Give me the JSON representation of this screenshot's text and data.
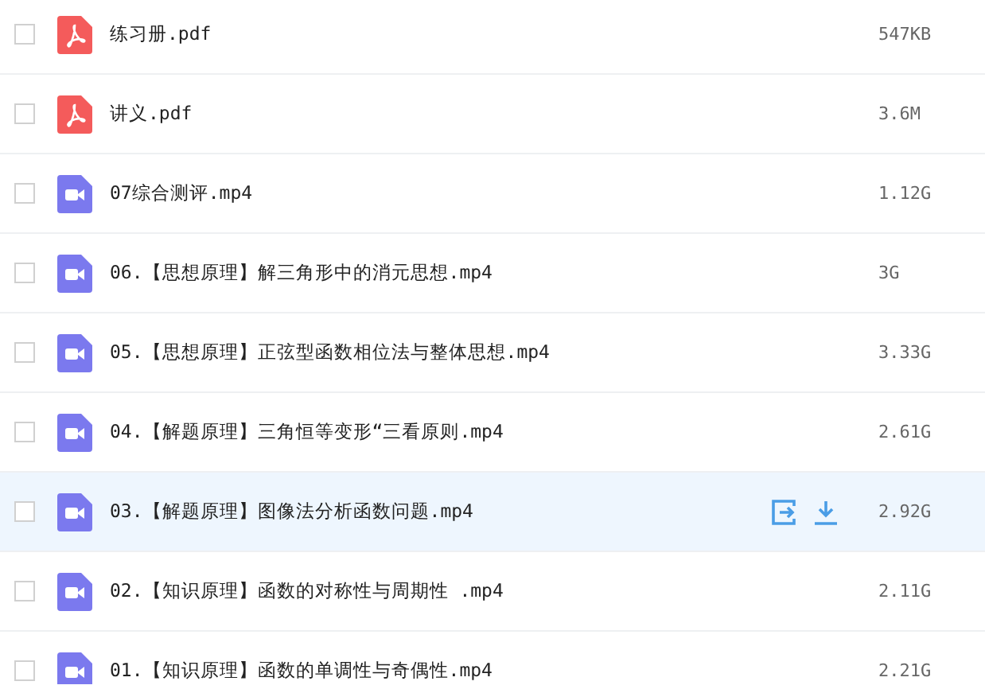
{
  "files": [
    {
      "kind": "pdf",
      "name": "练习册.pdf",
      "size": "547KB",
      "checked": false,
      "hovered": false
    },
    {
      "kind": "pdf",
      "name": "讲义.pdf",
      "size": "3.6M",
      "checked": false,
      "hovered": false
    },
    {
      "kind": "video",
      "name": "07综合测评.mp4",
      "size": "1.12G",
      "checked": false,
      "hovered": false
    },
    {
      "kind": "video",
      "name": "06.【思想原理】解三角形中的消元思想.mp4",
      "size": "3G",
      "checked": false,
      "hovered": false
    },
    {
      "kind": "video",
      "name": "05.【思想原理】正弦型函数相位法与整体思想.mp4",
      "size": "3.33G",
      "checked": false,
      "hovered": false
    },
    {
      "kind": "video",
      "name": "04.【解题原理】三角恒等变形“三看原则.mp4",
      "size": "2.61G",
      "checked": false,
      "hovered": false
    },
    {
      "kind": "video",
      "name": "03.【解题原理】图像法分析函数问题.mp4",
      "size": "2.92G",
      "checked": false,
      "hovered": true
    },
    {
      "kind": "video",
      "name": "02.【知识原理】函数的对称性与周期性 .mp4",
      "size": "2.11G",
      "checked": false,
      "hovered": false
    },
    {
      "kind": "video",
      "name": "01.【知识原理】函数的单调性与奇偶性.mp4",
      "size": "2.21G",
      "checked": false,
      "hovered": false
    }
  ]
}
